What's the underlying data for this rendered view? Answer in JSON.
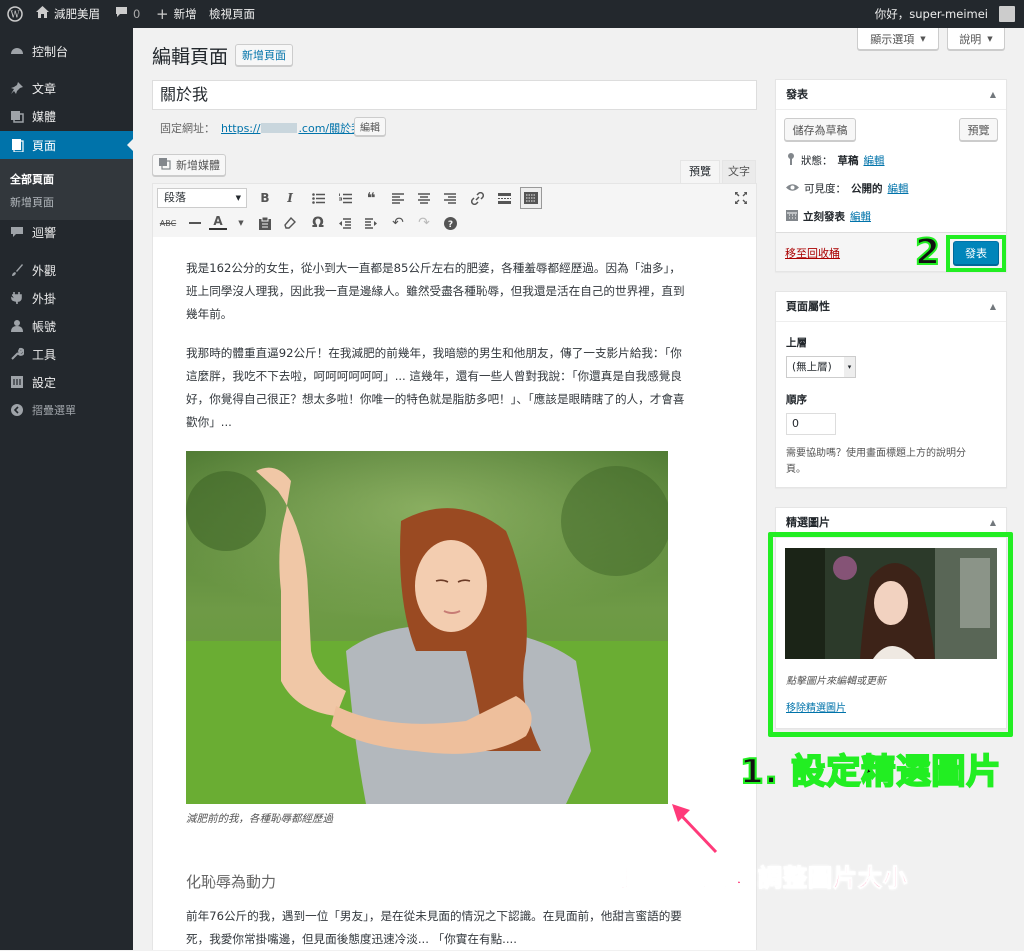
{
  "adminbar": {
    "site_name": "減肥美眉",
    "comments": "0",
    "new": "新增",
    "view": "檢視頁面",
    "greeting": "你好，super-meimei"
  },
  "menu": {
    "dashboard": "控制台",
    "posts": "文章",
    "media": "媒體",
    "pages": "頁面",
    "sub_all": "全部頁面",
    "sub_new": "新增頁面",
    "comments": "迴響",
    "appearance": "外觀",
    "plugins": "外掛",
    "users": "帳號",
    "tools": "工具",
    "settings": "設定",
    "collapse": "摺疊選單"
  },
  "screen": {
    "options": "顯示選項",
    "help": "說明"
  },
  "header": {
    "title": "編輯頁面",
    "add_new": "新增頁面"
  },
  "post": {
    "title": "關於我",
    "permalink_label": "固定網址：",
    "permalink_prefix": "https://",
    "permalink_suffix": ".com/關於我/",
    "edit_btn": "編輯"
  },
  "editor": {
    "add_media": "新增媒體",
    "tab_visual": "預覽",
    "tab_text": "文字",
    "format": "段落"
  },
  "content": {
    "p1": "我是162公分的女生，從小到大一直都是85公斤左右的肥婆，各種羞辱都經歷過。因為「油多」，班上同學沒人理我，因此我一直是邊緣人。雖然受盡各種恥辱，但我還是活在自己的世界裡，直到幾年前。",
    "p2": "我那時的體重直逼92公斤！在我減肥的前幾年，我暗戀的男生和他朋友，傳了一支影片給我：「你這麼胖，我吃不下去啦，呵呵呵呵呵呵」... 這幾年，還有一些人曾對我說：「你還真是自我感覺良好，你覺得自己很正？想太多啦！你唯一的特色就是脂肪多吧！」、「應該是眼睛瞎了的人，才會喜歡你」...",
    "caption": "減肥前的我，各種恥辱都經歷過",
    "heading": "化恥辱為動力",
    "p3": "前年76公斤的我，遇到一位「男友」，是在從未見面的情況之下認識。在見面前，他甜言蜜語的要死，我愛你常掛嘴邊，但見面後態度迅速冷淡... 「你實在有點...."
  },
  "publish": {
    "title": "發表",
    "save_draft": "儲存為草稿",
    "preview": "預覽",
    "status_label": "狀態：",
    "status_value": "草稿",
    "visibility_label": "可見度：",
    "visibility_value": "公開的",
    "schedule": "立刻發表",
    "edit": "編輯",
    "trash": "移至回收桶",
    "publish_btn": "發表"
  },
  "attributes": {
    "title": "頁面屬性",
    "parent_label": "上層",
    "parent_value": "(無上層)",
    "order_label": "順序",
    "order_value": "0",
    "help": "需要協助嗎？使用畫面標題上方的說明分頁。"
  },
  "featured": {
    "title": "精選圖片",
    "hint": "點擊圖片來編輯或更新",
    "remove": "移除精選圖片"
  },
  "annotations": {
    "step1": "1. 設定精選圖片",
    "step2": "2",
    "drag_tip": "可點擊拖曳，調整圖片大小"
  },
  "colors": {
    "highlight": "#22ee22",
    "pink": "#ff3a7a",
    "wp_blue": "#0073aa"
  }
}
